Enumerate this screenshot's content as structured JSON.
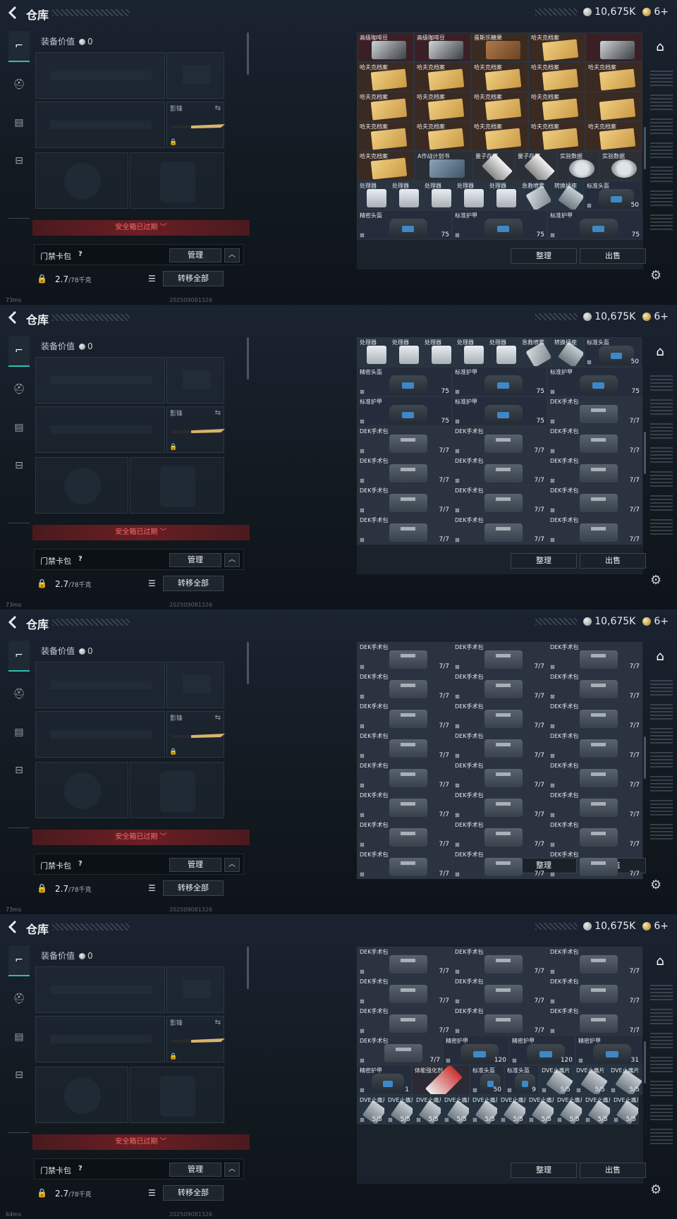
{
  "header": {
    "title": "仓库",
    "silver": "10,675K",
    "gold": "6+"
  },
  "left": {
    "equip_value_label": "装备价值",
    "equip_value": "0",
    "melee_label": "影锋",
    "expired": "安全箱已过期",
    "cardpack_label": "门禁卡包",
    "cardpack_help": "?",
    "manage": "管理",
    "weight": "2.7",
    "weight_max": "/78千克",
    "transfer_all": "转移全部"
  },
  "actions": {
    "sort": "整理",
    "sell": "出售"
  },
  "screens": [
    {
      "ping": "73ms",
      "build": "202509081326",
      "scroll": 0,
      "rows": [
        [
          {
            "n": "高级咖啡豆",
            "p": "coffee"
          },
          {
            "n": "高级咖啡豆",
            "p": "coffee"
          },
          {
            "n": "蛋斯乐糖果",
            "p": "brown"
          },
          {
            "n": "哈夫克档案",
            "p": "doc"
          },
          {
            "n": "",
            "p": "coffee"
          }
        ],
        [
          {
            "n": "哈夫克档案",
            "p": "doc"
          },
          {
            "n": "哈夫克档案",
            "p": "doc"
          },
          {
            "n": "哈夫克档案",
            "p": "doc"
          },
          {
            "n": "哈夫克档案",
            "p": "doc"
          },
          {
            "n": "哈夫克档案",
            "p": "doc"
          }
        ],
        [
          {
            "n": "哈夫克档案",
            "p": "doc"
          },
          {
            "n": "哈夫克档案",
            "p": "doc"
          },
          {
            "n": "哈夫克档案",
            "p": "doc"
          },
          {
            "n": "哈夫克档案",
            "p": "doc"
          },
          {
            "n": "",
            "p": "dark"
          }
        ],
        [
          {
            "n": "哈夫克档案",
            "p": "doc"
          },
          {
            "n": "哈夫克档案",
            "p": "doc"
          },
          {
            "n": "哈夫克档案",
            "p": "doc"
          },
          {
            "n": "哈夫克档案",
            "p": "doc"
          },
          {
            "n": "哈夫克档案",
            "p": "doc"
          }
        ],
        [
          {
            "n": "哈夫克档案",
            "p": "doc"
          },
          {
            "n": "A作战计划书",
            "p": "tin"
          },
          {
            "n": "量子存储",
            "p": "usb"
          },
          {
            "n": "量子存储",
            "p": "usb"
          },
          {
            "n": "实验数据",
            "p": "disc"
          },
          {
            "n": "实验数据",
            "p": "disc"
          }
        ],
        [
          {
            "n": "处理器",
            "p": "proc"
          },
          {
            "n": "处理器",
            "p": "proc"
          },
          {
            "n": "处理器",
            "p": "proc"
          },
          {
            "n": "处理器",
            "p": "proc"
          },
          {
            "n": "处理器",
            "p": "proc"
          },
          {
            "n": "急救喷雾",
            "p": "spray"
          },
          {
            "n": "转换插座",
            "p": "flask"
          },
          {
            "n": "标准头盔",
            "p": "vest",
            "c": "50"
          }
        ],
        [
          {
            "n": "精密头盔",
            "p": "vest",
            "c": "75"
          },
          {
            "n": "标准护甲",
            "p": "vest",
            "c": "75"
          },
          {
            "n": "标准护甲",
            "p": "vest",
            "c": "75"
          }
        ]
      ]
    },
    {
      "ping": "73ms",
      "build": "202509081326",
      "scroll": 0,
      "rows": [
        [
          {
            "n": "处理器",
            "p": "proc"
          },
          {
            "n": "处理器",
            "p": "proc"
          },
          {
            "n": "处理器",
            "p": "proc"
          },
          {
            "n": "处理器",
            "p": "proc"
          },
          {
            "n": "处理器",
            "p": "proc"
          },
          {
            "n": "急救喷雾",
            "p": "spray"
          },
          {
            "n": "转换插座",
            "p": "flask"
          },
          {
            "n": "标准头盔",
            "p": "vest",
            "c": "50"
          }
        ],
        [
          {
            "n": "精密头盔",
            "p": "vest",
            "c": "75"
          },
          {
            "n": "标准护甲",
            "p": "vest",
            "c": "75"
          },
          {
            "n": "标准护甲",
            "p": "vest",
            "c": "75"
          }
        ],
        [
          {
            "n": "标准护甲",
            "p": "vest",
            "c": "75"
          },
          {
            "n": "标准护甲",
            "p": "vest",
            "c": "75"
          },
          {
            "n": "DEK手术包",
            "p": "kit",
            "c": "7/7"
          }
        ],
        [
          {
            "n": "DEK手术包",
            "p": "kit",
            "c": "7/7"
          },
          {
            "n": "DEK手术包",
            "p": "kit",
            "c": "7/7"
          },
          {
            "n": "DEK手术包",
            "p": "kit",
            "c": "7/7"
          }
        ],
        [
          {
            "n": "DEK手术包",
            "p": "kit",
            "c": "7/7"
          },
          {
            "n": "DEK手术包",
            "p": "kit",
            "c": "7/7"
          },
          {
            "n": "DEK手术包",
            "p": "kit",
            "c": "7/7"
          }
        ],
        [
          {
            "n": "DEK手术包",
            "p": "kit",
            "c": "7/7"
          },
          {
            "n": "DEK手术包",
            "p": "kit",
            "c": "7/7"
          },
          {
            "n": "DEK手术包",
            "p": "kit",
            "c": "7/7"
          }
        ],
        [
          {
            "n": "DEK手术包",
            "p": "kit",
            "c": "7/7"
          },
          {
            "n": "DEK手术包",
            "p": "kit",
            "c": "7/7"
          },
          {
            "n": "DEK手术包",
            "p": "kit",
            "c": "7/7"
          }
        ]
      ]
    },
    {
      "ping": "73ms",
      "build": "202509081326",
      "scroll": 0,
      "rows": [
        [
          {
            "n": "DEK手术包",
            "p": "kit",
            "c": "7/7"
          },
          {
            "n": "DEK手术包",
            "p": "kit",
            "c": "7/7"
          },
          {
            "n": "DEK手术包",
            "p": "kit",
            "c": "7/7"
          }
        ],
        [
          {
            "n": "DEK手术包",
            "p": "kit",
            "c": "7/7"
          },
          {
            "n": "DEK手术包",
            "p": "kit",
            "c": "7/7"
          },
          {
            "n": "DEK手术包",
            "p": "kit",
            "c": "7/7"
          }
        ],
        [
          {
            "n": "DEK手术包",
            "p": "kit",
            "c": "7/7"
          },
          {
            "n": "DEK手术包",
            "p": "kit",
            "c": "7/7"
          },
          {
            "n": "DEK手术包",
            "p": "kit",
            "c": "7/7"
          }
        ],
        [
          {
            "n": "DEK手术包",
            "p": "kit",
            "c": "7/7"
          },
          {
            "n": "DEK手术包",
            "p": "kit",
            "c": "7/7"
          },
          {
            "n": "DEK手术包",
            "p": "kit",
            "c": "7/7"
          }
        ],
        [
          {
            "n": "DEK手术包",
            "p": "kit",
            "c": "7/7"
          },
          {
            "n": "DEK手术包",
            "p": "kit",
            "c": "7/7"
          },
          {
            "n": "DEK手术包",
            "p": "kit",
            "c": "7/7"
          }
        ],
        [
          {
            "n": "DEK手术包",
            "p": "kit",
            "c": "7/7"
          },
          {
            "n": "DEK手术包",
            "p": "kit",
            "c": "7/7"
          },
          {
            "n": "DEK手术包",
            "p": "kit",
            "c": "7/7"
          }
        ],
        [
          {
            "n": "DEK手术包",
            "p": "kit",
            "c": "7/7"
          },
          {
            "n": "DEK手术包",
            "p": "kit",
            "c": "7/7"
          },
          {
            "n": "DEK手术包",
            "p": "kit",
            "c": "7/7"
          }
        ],
        [
          {
            "n": "DEK手术包",
            "p": "kit",
            "c": "7/7"
          },
          {
            "n": "DEK手术包",
            "p": "kit",
            "c": "7/7"
          },
          {
            "n": "DEK手术包",
            "p": "kit",
            "c": "7/7"
          }
        ]
      ]
    },
    {
      "ping": "64ms",
      "build": "202509081326",
      "scroll": 0,
      "rows": [
        [
          {
            "n": "DEK手术包",
            "p": "kit",
            "c": "7/7"
          },
          {
            "n": "DEK手术包",
            "p": "kit",
            "c": "7/7"
          },
          {
            "n": "DEK手术包",
            "p": "kit",
            "c": "7/7"
          }
        ],
        [
          {
            "n": "DEK手术包",
            "p": "kit",
            "c": "7/7"
          },
          {
            "n": "DEK手术包",
            "p": "kit",
            "c": "7/7"
          },
          {
            "n": "DEK手术包",
            "p": "kit",
            "c": "7/7"
          }
        ],
        [
          {
            "n": "DEK手术包",
            "p": "kit",
            "c": "7/7"
          },
          {
            "n": "DEK手术包",
            "p": "kit",
            "c": "7/7"
          },
          {
            "n": "DEK手术包",
            "p": "kit",
            "c": "7/7"
          }
        ],
        [
          {
            "n": "DEK手术包",
            "p": "kit",
            "c": "7/7"
          },
          {
            "n": "精密护甲",
            "p": "vest",
            "c": "120"
          },
          {
            "n": "精密护甲",
            "p": "vest",
            "c": "120"
          },
          {
            "n": "精密护甲",
            "p": "vest",
            "c": "31"
          }
        ],
        [
          {
            "n": "精密护甲",
            "p": "vest",
            "c": "1"
          },
          {
            "n": "体能强化剂",
            "p": "syr"
          },
          {
            "n": "标准头盔",
            "p": "vest",
            "c": "50"
          },
          {
            "n": "标准头盔",
            "p": "vest",
            "c": "9"
          },
          {
            "n": "DVE止痛片",
            "p": "flask",
            "c": "5/5"
          },
          {
            "n": "DVE止痛片",
            "p": "flask",
            "c": "5/5"
          },
          {
            "n": "DVE止痛片",
            "p": "flask",
            "c": "5/5"
          }
        ],
        [
          {
            "n": "DVE止痛片",
            "p": "flask",
            "c": "5/5"
          },
          {
            "n": "DVE止痛片",
            "p": "flask",
            "c": "5/5"
          },
          {
            "n": "DVE止痛片",
            "p": "flask",
            "c": "5/5"
          },
          {
            "n": "DVE止痛片",
            "p": "flask",
            "c": "5/5"
          },
          {
            "n": "DVE止痛片",
            "p": "flask",
            "c": "5/5"
          },
          {
            "n": "DVE止痛片",
            "p": "flask",
            "c": "5/5"
          },
          {
            "n": "DVE止痛片",
            "p": "flask",
            "c": "5/5"
          },
          {
            "n": "DVE止痛片",
            "p": "flask",
            "c": "5/5"
          },
          {
            "n": "DVE止痛片",
            "p": "flask",
            "c": "5/5"
          },
          {
            "n": "DVE止痛片",
            "p": "flask",
            "c": "5/5"
          }
        ]
      ]
    }
  ]
}
